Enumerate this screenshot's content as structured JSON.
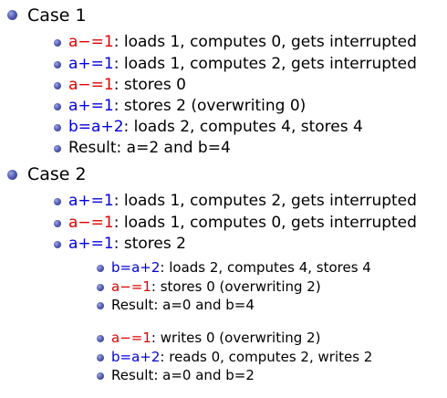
{
  "case1": {
    "title": "Case 1",
    "items": [
      {
        "code": "a−=1",
        "code_color": "red",
        "text": ": loads 1, computes 0, gets interrupted"
      },
      {
        "code": "a+=1",
        "code_color": "blue",
        "text": ": loads 1, computes 2, gets interrupted"
      },
      {
        "code": "a−=1",
        "code_color": "red",
        "text": ": stores 0"
      },
      {
        "code": "a+=1",
        "code_color": "blue",
        "text": ": stores 2 (overwriting 0)"
      },
      {
        "code": "b=a+2",
        "code_color": "blue",
        "text": ": loads 2, computes 4, stores 4"
      },
      {
        "code": "",
        "code_color": "",
        "text": "Result: a=2 and b=4"
      }
    ]
  },
  "case2": {
    "title": "Case 2",
    "items": [
      {
        "code": "a+=1",
        "code_color": "blue",
        "text": ": loads 1, computes 2, gets interrupted"
      },
      {
        "code": "a−=1",
        "code_color": "red",
        "text": ": loads 1, computes 0, gets interrupted"
      },
      {
        "code": "a+=1",
        "code_color": "blue",
        "text": ": stores 2"
      }
    ],
    "sub_a": [
      {
        "code": "b=a+2",
        "code_color": "blue",
        "text": ": loads 2, computes 4, stores 4"
      },
      {
        "code": "a−=1",
        "code_color": "red",
        "text": ": stores 0 (overwriting 2)"
      },
      {
        "code": "",
        "code_color": "",
        "text": "Result: a=0 and b=4"
      }
    ],
    "sub_b": [
      {
        "code": "a−=1",
        "code_color": "red",
        "text": ": writes 0 (overwriting 2)"
      },
      {
        "code": "b=a+2",
        "code_color": "blue",
        "text": ": reads 0, computes 2, writes 2"
      },
      {
        "code": "",
        "code_color": "",
        "text": "Result: a=0 and b=2"
      }
    ]
  },
  "colors": {
    "red": "#e00000",
    "blue": "#0000e0",
    "bullet": "#3a44a0"
  },
  "icons": {
    "bullet": "bullet-ball-icon"
  }
}
